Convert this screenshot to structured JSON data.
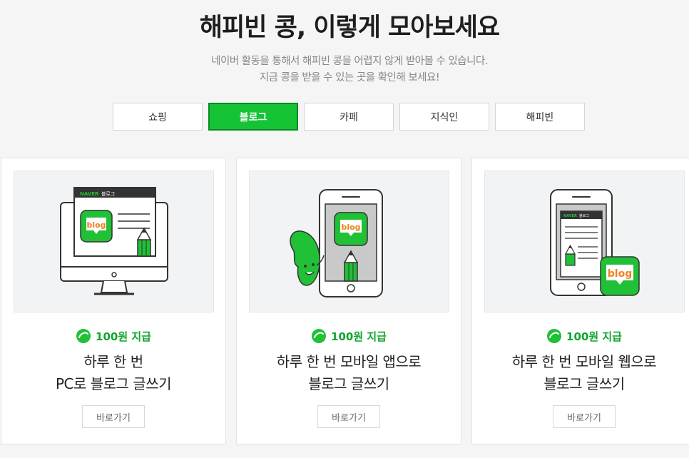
{
  "header": {
    "title": "해피빈 콩, 이렇게 모아보세요",
    "desc_line1": "네이버 활동을 통해서 해피빈 콩을 어렵지 않게 받아볼 수 있습니다.",
    "desc_line2": "지금 콩을 받을 수 있는 곳을 확인해 보세요!"
  },
  "tabs": [
    {
      "label": "쇼핑"
    },
    {
      "label": "블로그"
    },
    {
      "label": "카페"
    },
    {
      "label": "지식인"
    },
    {
      "label": "해피빈"
    }
  ],
  "colors": {
    "accent": "#14c435",
    "reward": "#11a52d"
  },
  "cards": [
    {
      "reward": "100원 지급",
      "title_line1": "하루 한 번",
      "title_line2": "PC로 블로그 글쓰기",
      "button": "바로가기",
      "illus_naver": "NAVER",
      "illus_blog_tab": "블로그",
      "illus_blog_logo": "blog"
    },
    {
      "reward": "100원 지급",
      "title_line1": "하루 한 번 모바일 앱으로",
      "title_line2": "블로그 글쓰기",
      "button": "바로가기",
      "illus_blog_logo": "blog"
    },
    {
      "reward": "100원 지급",
      "title_line1": "하루 한 번 모바일 웹으로",
      "title_line2": "블로그 글쓰기",
      "button": "바로가기",
      "illus_naver": "NAVER",
      "illus_blog_tab": "블로그",
      "illus_blog_logo": "blog"
    }
  ]
}
